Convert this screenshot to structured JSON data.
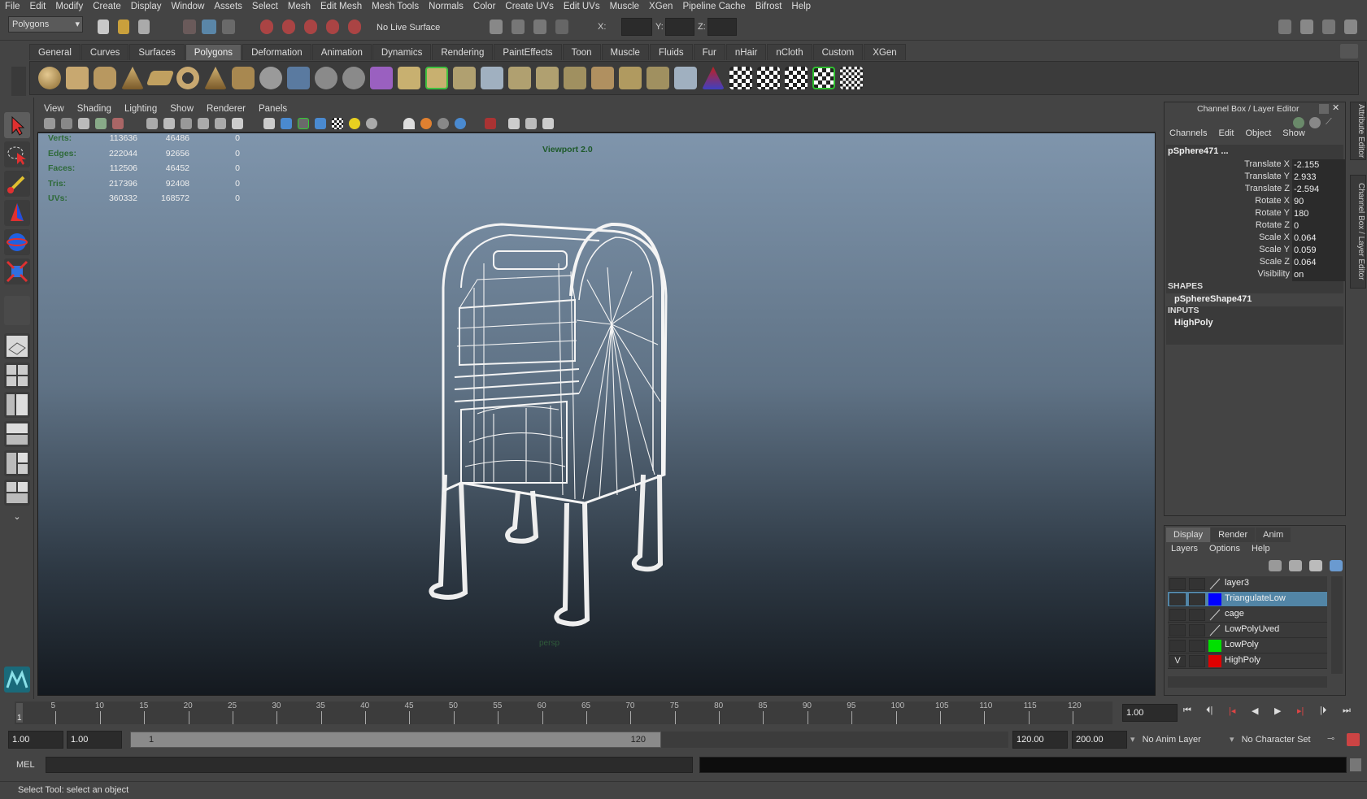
{
  "menubar": [
    "File",
    "Edit",
    "Modify",
    "Create",
    "Display",
    "Window",
    "Assets",
    "Select",
    "Mesh",
    "Edit Mesh",
    "Mesh Tools",
    "Normals",
    "Color",
    "Create UVs",
    "Edit UVs",
    "Muscle",
    "XGen",
    "Pipeline Cache",
    "Bifrost",
    "Help"
  ],
  "statusline": {
    "menuset": "Polygons",
    "live_surface": "No Live Surface",
    "x_label": "X:",
    "y_label": "Y:",
    "z_label": "Z:"
  },
  "shelf_tabs": [
    "General",
    "Curves",
    "Surfaces",
    "Polygons",
    "Deformation",
    "Animation",
    "Dynamics",
    "Rendering",
    "PaintEffects",
    "Toon",
    "Muscle",
    "Fluids",
    "Fur",
    "nHair",
    "nCloth",
    "Custom",
    "XGen"
  ],
  "active_shelf_tab": "Polygons",
  "viewport": {
    "menu": [
      "View",
      "Shading",
      "Lighting",
      "Show",
      "Renderer",
      "Panels"
    ],
    "renderer_label": "Viewport 2.0",
    "camera_label": "persp",
    "hud": [
      {
        "label": "Verts:",
        "v1": "113636",
        "v2": "46486",
        "v3": "0"
      },
      {
        "label": "Edges:",
        "v1": "222044",
        "v2": "92656",
        "v3": "0"
      },
      {
        "label": "Faces:",
        "v1": "112506",
        "v2": "46452",
        "v3": "0"
      },
      {
        "label": "Tris:",
        "v1": "217396",
        "v2": "92408",
        "v3": "0"
      },
      {
        "label": "UVs:",
        "v1": "360332",
        "v2": "168572",
        "v3": "0"
      }
    ]
  },
  "channel_box": {
    "title": "Channel Box / Layer Editor",
    "menu": [
      "Channels",
      "Edit",
      "Object",
      "Show"
    ],
    "object_name": "pSphere471 ...",
    "attrs": [
      {
        "label": "Translate X",
        "value": "-2.155"
      },
      {
        "label": "Translate Y",
        "value": "2.933"
      },
      {
        "label": "Translate Z",
        "value": "-2.594"
      },
      {
        "label": "Rotate X",
        "value": "90"
      },
      {
        "label": "Rotate Y",
        "value": "180"
      },
      {
        "label": "Rotate Z",
        "value": "0"
      },
      {
        "label": "Scale X",
        "value": "0.064"
      },
      {
        "label": "Scale Y",
        "value": "0.059"
      },
      {
        "label": "Scale Z",
        "value": "0.064"
      },
      {
        "label": "Visibility",
        "value": "on"
      }
    ],
    "shapes_header": "SHAPES",
    "shape_name": "pSphereShape471",
    "inputs_header": "INPUTS",
    "input_name": "HighPoly"
  },
  "side_tabs": {
    "attribute_editor": "Attribute Editor",
    "channel_box": "Channel Box / Layer Editor"
  },
  "layer_editor": {
    "tabs": [
      "Display",
      "Render",
      "Anim"
    ],
    "menu": [
      "Layers",
      "Options",
      "Help"
    ],
    "layers": [
      {
        "name": "layer3",
        "color": "",
        "v": "",
        "selected": false
      },
      {
        "name": "TriangulateLow",
        "color": "#0000ff",
        "v": "",
        "selected": true
      },
      {
        "name": "cage",
        "color": "",
        "v": "",
        "selected": false
      },
      {
        "name": "LowPolyUved",
        "color": "",
        "v": "",
        "selected": false
      },
      {
        "name": "LowPoly",
        "color": "#00e000",
        "v": "",
        "selected": false
      },
      {
        "name": "HighPoly",
        "color": "#e00000",
        "v": "V",
        "selected": false
      }
    ]
  },
  "timeline": {
    "ticks": [
      "5",
      "10",
      "15",
      "20",
      "25",
      "30",
      "35",
      "40",
      "45",
      "50",
      "55",
      "60",
      "65",
      "70",
      "75",
      "80",
      "85",
      "90",
      "95",
      "100",
      "105",
      "110",
      "115",
      "120"
    ],
    "first_frame": "1",
    "current_frame": "1.00"
  },
  "range": {
    "start": "1.00",
    "start2": "1.00",
    "slider_start": "1",
    "slider_end": "120",
    "end": "120.00",
    "end2": "200.00",
    "anim_layer": "No Anim Layer",
    "char_set": "No Character Set"
  },
  "cmdline": {
    "label": "MEL"
  },
  "helpline": {
    "text": "Select Tool: select an object"
  }
}
